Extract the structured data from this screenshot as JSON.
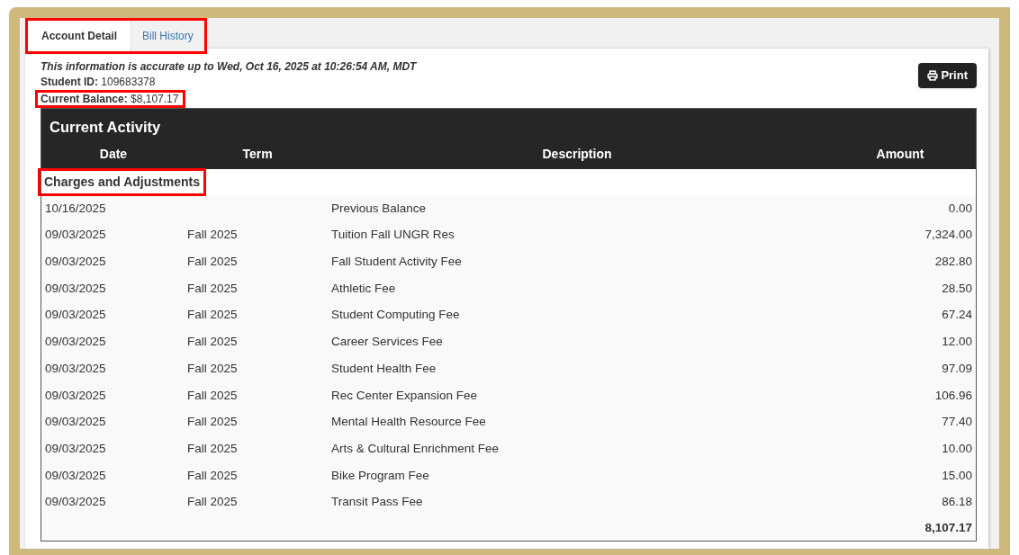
{
  "tabs": [
    {
      "label": "Account Detail",
      "selected": true
    },
    {
      "label": "Bill History",
      "selected": false
    }
  ],
  "info": {
    "accuracy_note": "This information is accurate up to Wed, Oct 16, 2025 at 10:26:54 AM, MDT",
    "student_id_label": "Student ID:",
    "student_id": "109683378",
    "balance_label": "Current Balance:",
    "balance": "$8,107.17"
  },
  "print_button": "Print",
  "table": {
    "title": "Current Activity",
    "columns": [
      "Date",
      "Term",
      "Description",
      "Amount"
    ],
    "section": "Charges and Adjustments",
    "rows": [
      {
        "date": "10/16/2025",
        "term": "",
        "description": "Previous Balance",
        "amount": "0.00"
      },
      {
        "date": "09/03/2025",
        "term": "Fall 2025",
        "description": "Tuition Fall UNGR Res",
        "amount": "7,324.00"
      },
      {
        "date": "09/03/2025",
        "term": "Fall 2025",
        "description": "Fall Student Activity Fee",
        "amount": "282.80"
      },
      {
        "date": "09/03/2025",
        "term": "Fall 2025",
        "description": "Athletic Fee",
        "amount": "28.50"
      },
      {
        "date": "09/03/2025",
        "term": "Fall 2025",
        "description": "Student Computing Fee",
        "amount": "67.24"
      },
      {
        "date": "09/03/2025",
        "term": "Fall 2025",
        "description": "Career Services Fee",
        "amount": "12.00"
      },
      {
        "date": "09/03/2025",
        "term": "Fall 2025",
        "description": "Student Health Fee",
        "amount": "97.09"
      },
      {
        "date": "09/03/2025",
        "term": "Fall 2025",
        "description": "Rec Center Expansion Fee",
        "amount": "106.96"
      },
      {
        "date": "09/03/2025",
        "term": "Fall 2025",
        "description": "Mental Health Resource Fee",
        "amount": "77.40"
      },
      {
        "date": "09/03/2025",
        "term": "Fall 2025",
        "description": "Arts & Cultural Enrichment Fee",
        "amount": "10.00"
      },
      {
        "date": "09/03/2025",
        "term": "Fall 2025",
        "description": "Bike Program Fee",
        "amount": "15.00"
      },
      {
        "date": "09/03/2025",
        "term": "Fall 2025",
        "description": "Transit Pass Fee",
        "amount": "86.18"
      }
    ],
    "total": "8,107.17"
  }
}
